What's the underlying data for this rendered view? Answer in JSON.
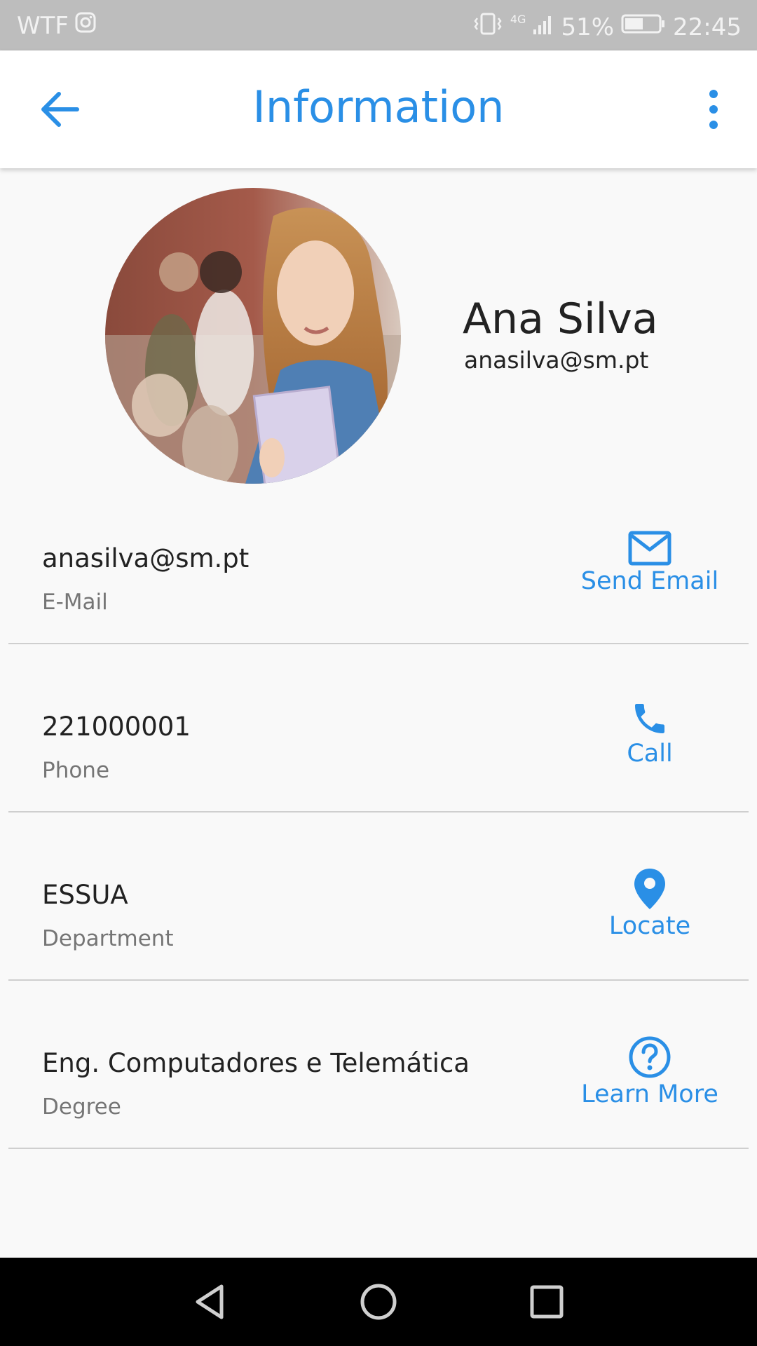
{
  "status_bar": {
    "carrier": "WTF",
    "network": "4G",
    "battery": "51%",
    "time": "22:45"
  },
  "app_bar": {
    "title": "Information"
  },
  "profile": {
    "name": "Ana Silva",
    "email": "anasilva@sm.pt"
  },
  "rows": [
    {
      "value": "anasilva@sm.pt",
      "label": "E-Mail",
      "action": "Send Email",
      "icon": "mail-icon"
    },
    {
      "value": "221000001",
      "label": "Phone",
      "action": "Call",
      "icon": "phone-icon"
    },
    {
      "value": "ESSUA",
      "label": "Department",
      "action": "Locate",
      "icon": "location-pin-icon"
    },
    {
      "value": "Eng. Computadores e Telemática",
      "label": "Degree",
      "action": "Learn More",
      "icon": "help-circle-icon"
    }
  ],
  "colors": {
    "accent": "#2a8fe6",
    "status_bar": "#bdbdbd",
    "background": "#f9f9f9",
    "nav_bar": "#000000"
  }
}
